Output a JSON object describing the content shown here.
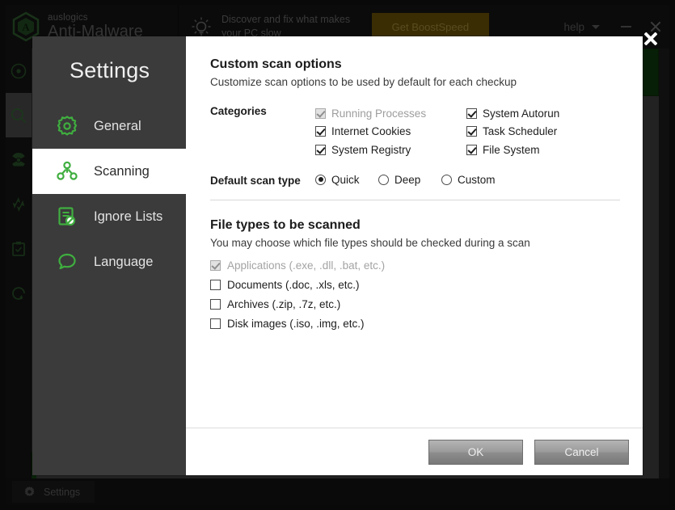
{
  "app": {
    "brand_small": "auslogics",
    "brand_big": "Anti-Malware",
    "promo_text": "Discover and fix what makes your PC slow",
    "boost_button": "Get BoostSpeed",
    "help_label": "help",
    "status_settings": "Settings",
    "rail_items": [
      {
        "name": "overview-icon"
      },
      {
        "name": "scan-icon"
      },
      {
        "name": "threats-icon"
      },
      {
        "name": "quarantine-icon"
      },
      {
        "name": "reports-icon"
      },
      {
        "name": "update-icon"
      }
    ]
  },
  "dialog": {
    "title": "Settings",
    "close_label": "",
    "nav": [
      {
        "label": "General",
        "icon": "gear-icon",
        "selected": false
      },
      {
        "label": "Scanning",
        "icon": "network-icon",
        "selected": true
      },
      {
        "label": "Ignore Lists",
        "icon": "ignore-list-icon",
        "selected": false
      },
      {
        "label": "Language",
        "icon": "speech-icon",
        "selected": false
      }
    ],
    "scan": {
      "heading": "Custom scan options",
      "subheading": "Customize scan options to be used by default for each checkup",
      "categories_label": "Categories",
      "categories_col1": [
        {
          "label": "Running Processes",
          "checked": true,
          "disabled": true
        },
        {
          "label": "Internet Cookies",
          "checked": true,
          "disabled": false
        },
        {
          "label": "System Registry",
          "checked": true,
          "disabled": false
        }
      ],
      "categories_col2": [
        {
          "label": "System Autorun",
          "checked": true,
          "disabled": false
        },
        {
          "label": "Task Scheduler",
          "checked": true,
          "disabled": false
        },
        {
          "label": "File System",
          "checked": true,
          "disabled": false
        }
      ],
      "scan_type_label": "Default scan type",
      "scan_types": [
        {
          "label": "Quick",
          "selected": true
        },
        {
          "label": "Deep",
          "selected": false
        },
        {
          "label": "Custom",
          "selected": false
        }
      ]
    },
    "file_types": {
      "heading": "File types to be scanned",
      "subheading": "You may choose which file types should be checked during a scan",
      "items": [
        {
          "label": "Applications (.exe, .dll, .bat, etc.)",
          "checked": true,
          "disabled": true
        },
        {
          "label": "Documents (.doc, .xls, etc.)",
          "checked": false,
          "disabled": false
        },
        {
          "label": "Archives (.zip, .7z, etc.)",
          "checked": false,
          "disabled": false
        },
        {
          "label": "Disk images (.iso, .img, etc.)",
          "checked": false,
          "disabled": false
        }
      ]
    },
    "footer": {
      "ok": "OK",
      "cancel": "Cancel"
    }
  },
  "colors": {
    "accent_green": "#3fae3f",
    "dialog_sidebar": "#3b3b3b",
    "boost_gold": "#6b5208"
  }
}
